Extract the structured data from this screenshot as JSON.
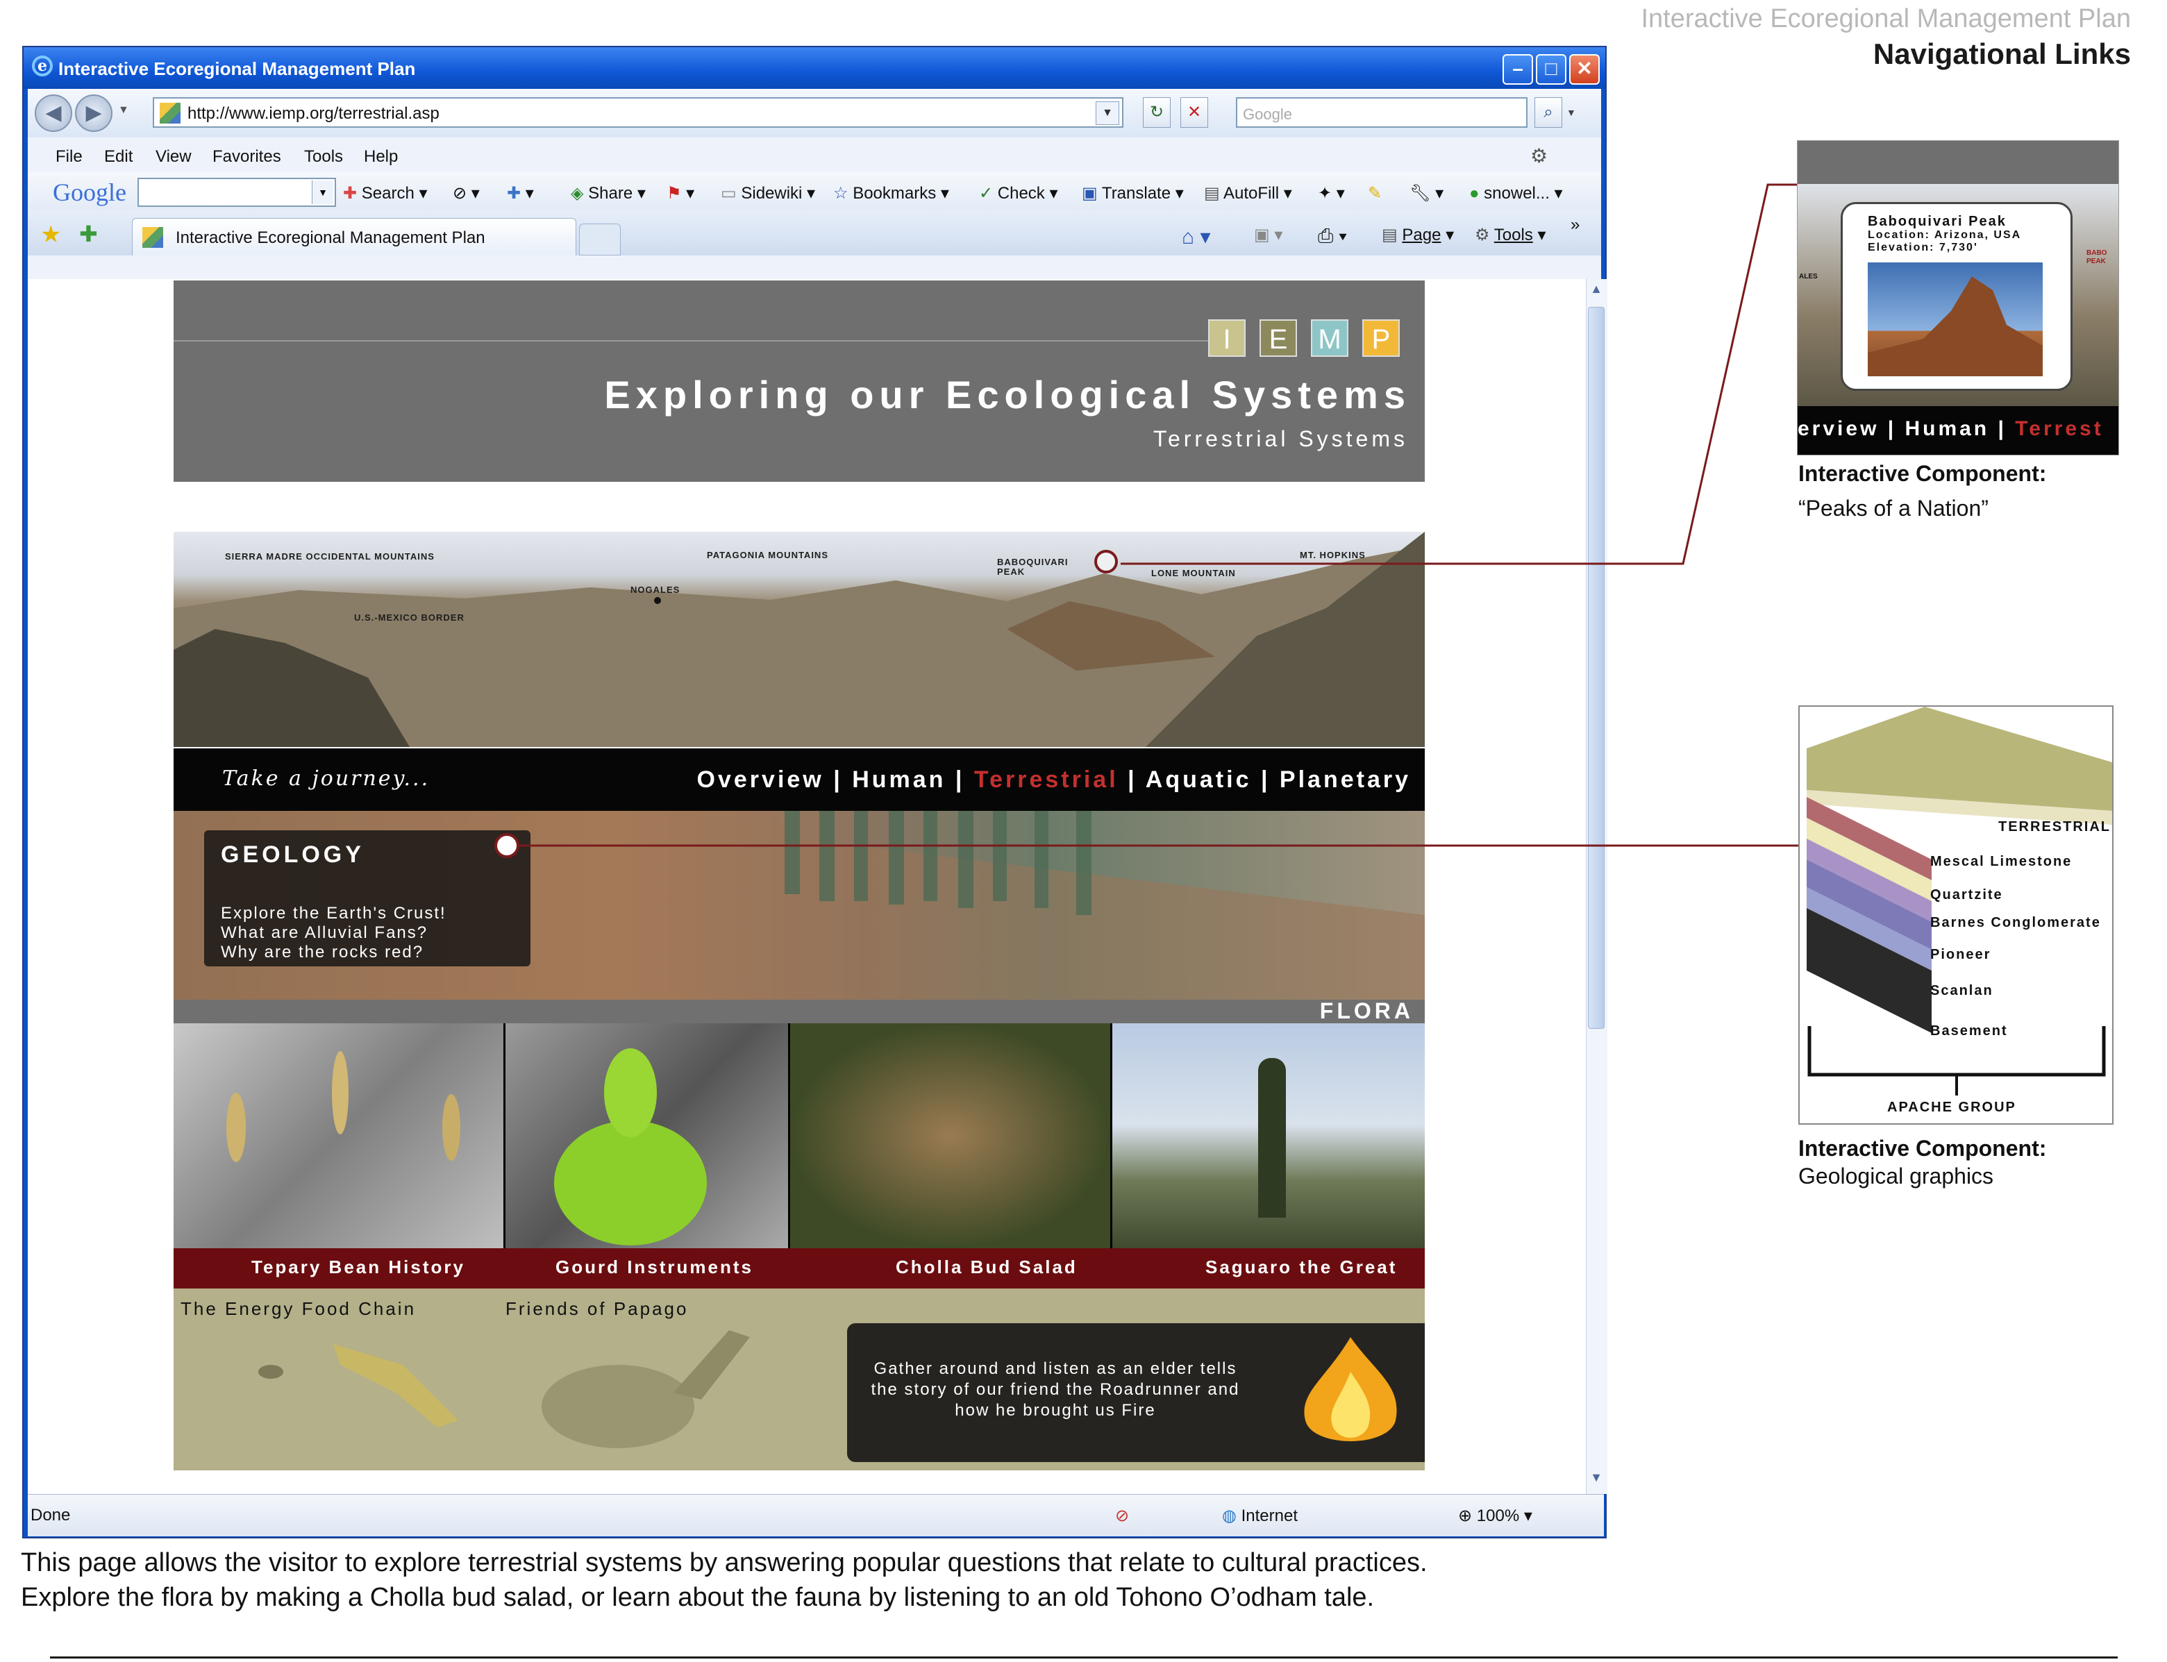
{
  "header": {
    "doc_title": "Interactive Ecoregional Management Plan",
    "section": "Navigational Links"
  },
  "browser": {
    "window_title": "Interactive Ecoregional Management Plan",
    "url": "http://www.iemp.org/terrestrial.asp",
    "search_placeholder": "Google",
    "menu": [
      "File",
      "Edit",
      "View",
      "Favorites",
      "Tools",
      "Help"
    ],
    "google_toolbar": {
      "logo": "Google",
      "items": [
        "Search",
        "Share",
        "Sidewiki",
        "Bookmarks",
        "Check",
        "Translate",
        "AutoFill",
        "snowel..."
      ]
    },
    "tab_title": "Interactive Ecoregional Management Plan",
    "command_bar": [
      "Page",
      "Tools"
    ],
    "status": {
      "left": "Done",
      "zone": "Internet",
      "zoom": "100%"
    }
  },
  "site": {
    "logo_letters": [
      "I",
      "E",
      "M",
      "P"
    ],
    "logo_colors": [
      "#c9c38e",
      "#8c8a5c",
      "#8ec6c8",
      "#f2b938"
    ],
    "title": "Exploring our Ecological Systems",
    "subtitle": "Terrestrial Systems",
    "panorama_labels": {
      "sierra": "SIERRA MADRE OCCIDENTAL MOUNTAINS",
      "patagonia": "PATAGONIA MOUNTAINS",
      "baboquivari_1": "BABOQUIVARI",
      "baboquivari_2": "PEAK",
      "hopkins": "MT. HOPKINS",
      "nogales": "NOGALES",
      "lone": "LONE MOUNTAIN",
      "border": "U.S.-MEXICO BORDER"
    },
    "take_journey": "Take a journey...",
    "nav": {
      "overview": "Overview",
      "human": "Human",
      "terrestrial": "Terrestrial",
      "aquatic": "Aquatic",
      "planetary": "Planetary",
      "sep": "|"
    },
    "geology": {
      "title": "GEOLOGY",
      "lines": [
        "Explore the Earth's Crust!",
        "What are Alluvial Fans?",
        "Why are the rocks red?"
      ]
    },
    "flora_label": "FLORA",
    "flora_items": [
      "Tepary Bean History",
      "Gourd Instruments",
      "Cholla Bud Salad",
      "Saguaro the Great"
    ],
    "fauna": {
      "energy": "The Energy Food Chain",
      "friends": "Friends of Papago",
      "story_lines": [
        "Gather around and listen as an elder tells",
        "the story of our friend the Roadrunner and",
        "how he brought us Fire"
      ]
    }
  },
  "annotations": {
    "peaks": {
      "card_title": "Baboquivari Peak",
      "card_location": "Location: Arizona, USA",
      "card_elevation": "Elevation: 7,730'",
      "card_nav": "erview  |  Human  |  ",
      "card_nav_active": "Terrest",
      "side_left": "ALES",
      "side_right_1": "BABO",
      "side_right_2": "PEAK",
      "label": "Interactive Component:",
      "desc": "“Peaks of a Nation”"
    },
    "geo": {
      "layers": [
        "TERRESTRIAL",
        "Mescal Limestone",
        "Quartzite",
        "Barnes Conglomerate",
        "Pioneer",
        "Scanlan",
        "Basement"
      ],
      "group": "APACHE GROUP",
      "label": "Interactive Component:",
      "desc": "Geological graphics"
    }
  },
  "caption": {
    "line1": "This page allows the visitor to explore terrestrial systems by answering popular questions that relate to cultural practices.",
    "line2": "Explore the flora by making a Cholla bud salad, or learn about the fauna by listening to an old Tohono O’odham tale."
  },
  "colors": {
    "title_bar": "#0f57d6",
    "banner": "#6f6f6f",
    "nav_active": "#c4302e",
    "flora_band": "#6b0d10",
    "fauna_band": "#b3b08a",
    "callout_line": "#7a1a1c"
  }
}
